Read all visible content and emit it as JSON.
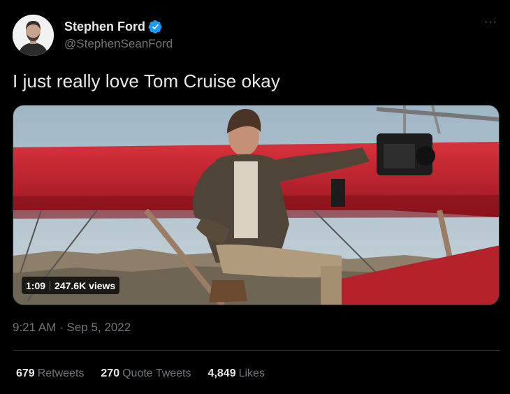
{
  "author": {
    "display_name": "Stephen Ford",
    "handle": "@StephenSeanFord",
    "verified": true,
    "avatar_icon": "profile-photo"
  },
  "tweet": {
    "text": "I just really love Tom Cruise okay",
    "more_icon": "ellipsis-icon",
    "more_label": "···"
  },
  "media": {
    "kind": "video",
    "duration": "1:09",
    "views": "247.6K views"
  },
  "meta": {
    "time": "9:21 AM",
    "separator": "·",
    "date": "Sep 5, 2022"
  },
  "stats": [
    {
      "count": "679",
      "label": "Retweets"
    },
    {
      "count": "270",
      "label": "Quote Tweets"
    },
    {
      "count": "4,849",
      "label": "Likes"
    }
  ],
  "colors": {
    "background": "#000000",
    "text_primary": "#e7e9ea",
    "text_secondary": "#71767b",
    "verified_blue": "#1d9bf0",
    "divider": "#2f3336"
  }
}
